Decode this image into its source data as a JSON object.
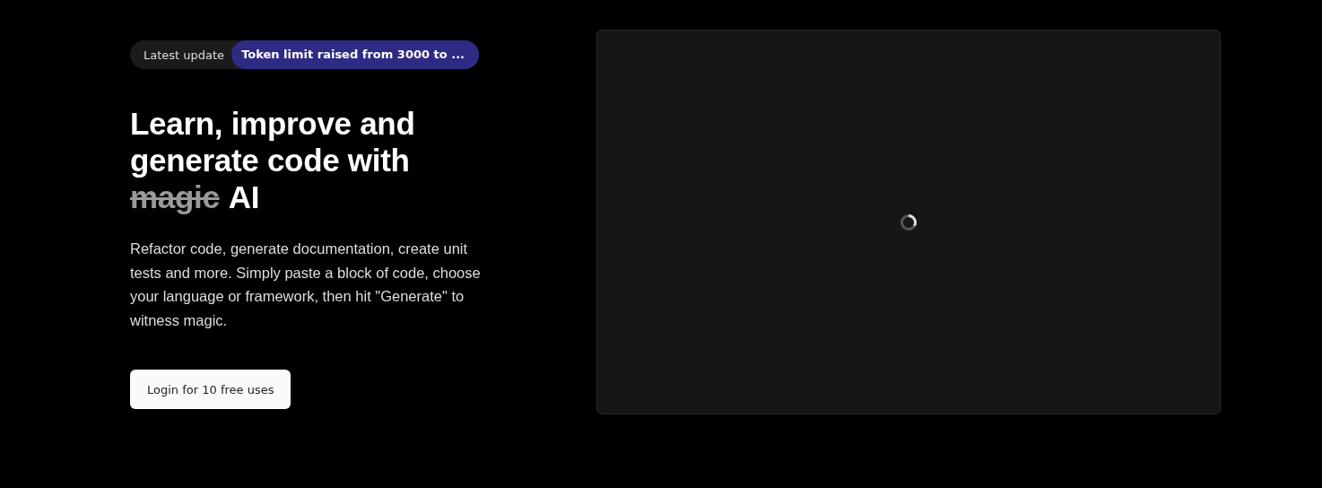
{
  "update_pill": {
    "label": "Latest update",
    "message": "Token limit raised from 3000 to ..."
  },
  "heading": {
    "lines": [
      "Learn, improve and",
      "generate code with"
    ],
    "struck": "magic",
    "tail": "AI"
  },
  "description": "Refactor code, generate documentation, create unit tests and more. Simply paste a block of code, choose your language or framework, then hit \"Generate\" to witness magic.",
  "login_button": "Login for 10 free uses",
  "preview_panel": {
    "loading": true
  }
}
